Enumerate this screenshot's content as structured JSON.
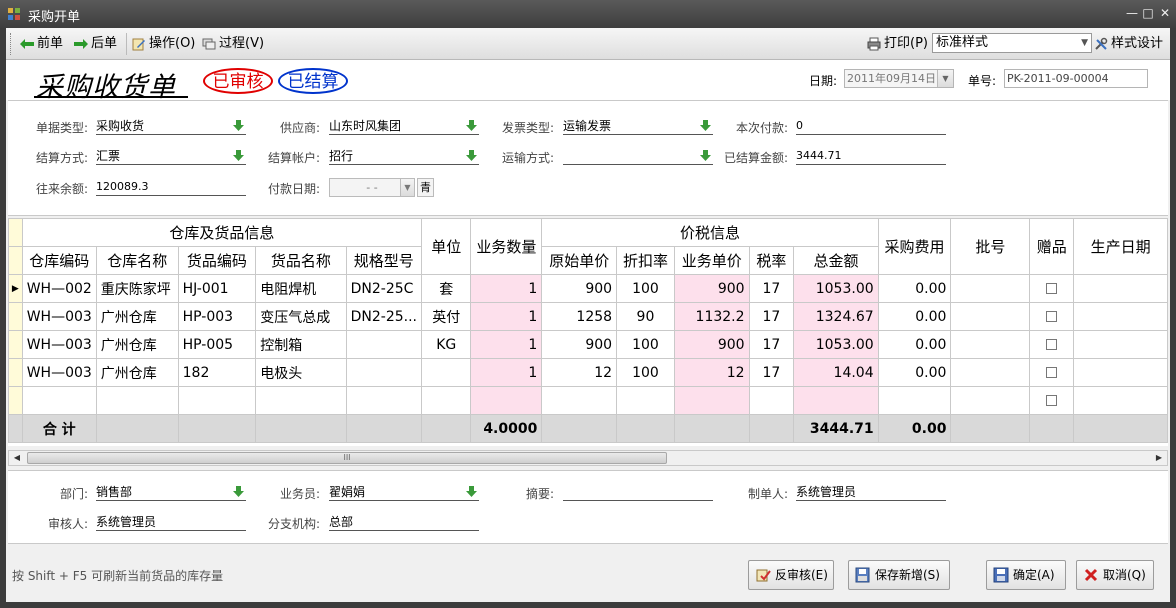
{
  "window": {
    "title": "采购开单",
    "min": "—",
    "max": "□",
    "close": "✕"
  },
  "toolbar": {
    "prev": "前单",
    "next": "后单",
    "operate": "操作(O)",
    "process": "过程(V)",
    "print": "打印(P)",
    "style_value": "标准样式",
    "style_design": "样式设计"
  },
  "header": {
    "title": "采购收货单",
    "stamp_audited": "已审核",
    "stamp_settled": "已结算",
    "date_label": "日期:",
    "date_value": "2011年09月14日",
    "no_label": "单号:",
    "no_value": "PK-2011-09-00004"
  },
  "form": {
    "bill_type_label": "单据类型:",
    "bill_type": "采购收货",
    "supplier_label": "供应商:",
    "supplier": "山东时风集团",
    "invoice_type_label": "发票类型:",
    "invoice_type": "运输发票",
    "pay_now_label": "本次付款:",
    "pay_now": "0",
    "settle_method_label": "结算方式:",
    "settle_method": "汇票",
    "settle_account_label": "结算帐户:",
    "settle_account": "招行",
    "transport_label": "运输方式:",
    "transport": "",
    "settled_amount_label": "已结算金额:",
    "settled_amount": "3444.71",
    "balance_label": "往来余额:",
    "balance": "120089.3",
    "pay_date_label": "付款日期:",
    "pay_date": "-  -",
    "pay_date_btn": "青"
  },
  "grid": {
    "group_warehouse": "仓库及货品信息",
    "group_price": "价税信息",
    "columns": {
      "wh_code": "仓库编码",
      "wh_name": "仓库名称",
      "item_code": "货品编码",
      "item_name": "货品名称",
      "spec": "规格型号",
      "unit": "单位",
      "qty": "业务数量",
      "orig_price": "原始单价",
      "discount": "折扣率",
      "price": "业务单价",
      "tax": "税率",
      "total": "总金额",
      "fee": "采购费用",
      "batch": "批号",
      "gift": "赠品",
      "mfg_date": "生产日期"
    },
    "rows": [
      {
        "wh_code": "WH—002",
        "wh_name": "重庆陈家坪",
        "item_code": "HJ-001",
        "item_name": "电阻焊机",
        "spec": "DN2-25C",
        "unit": "套",
        "qty": "1",
        "orig_price": "900",
        "discount": "100",
        "price": "900",
        "tax": "17",
        "total": "1053.00",
        "fee": "0.00"
      },
      {
        "wh_code": "WH—003",
        "wh_name": "广州仓库",
        "item_code": "HP-003",
        "item_name": "变压气总成",
        "spec": "DN2-25...",
        "unit": "英付",
        "qty": "1",
        "orig_price": "1258",
        "discount": "90",
        "price": "1132.2",
        "tax": "17",
        "total": "1324.67",
        "fee": "0.00"
      },
      {
        "wh_code": "WH—003",
        "wh_name": "广州仓库",
        "item_code": "HP-005",
        "item_name": "控制箱",
        "spec": "",
        "unit": "KG",
        "qty": "1",
        "orig_price": "900",
        "discount": "100",
        "price": "900",
        "tax": "17",
        "total": "1053.00",
        "fee": "0.00"
      },
      {
        "wh_code": "WH—003",
        "wh_name": "广州仓库",
        "item_code": "182",
        "item_name": "电极头",
        "spec": "",
        "unit": "",
        "qty": "1",
        "orig_price": "12",
        "discount": "100",
        "price": "12",
        "tax": "17",
        "total": "14.04",
        "fee": "0.00"
      }
    ],
    "total_label": "合  计",
    "total_qty": "4.0000",
    "total_amount": "3444.71",
    "total_fee": "0.00",
    "current_row_marker": "▶"
  },
  "scrollbar": {
    "grip": "III"
  },
  "footer": {
    "dept_label": "部门:",
    "dept": "销售部",
    "salesman_label": "业务员:",
    "salesman": "翟娟娟",
    "summary_label": "摘要:",
    "summary": "",
    "maker_label": "制单人:",
    "maker": "系统管理员",
    "auditor_label": "审核人:",
    "auditor": "系统管理员",
    "branch_label": "分支机构:",
    "branch": "总部"
  },
  "status": {
    "hint": "按 Shift + F5 可刷新当前货品的库存量",
    "unaudit": "反审核(E)",
    "save_new": "保存新增(S)",
    "ok": "确定(A)",
    "cancel": "取消(Q)"
  }
}
